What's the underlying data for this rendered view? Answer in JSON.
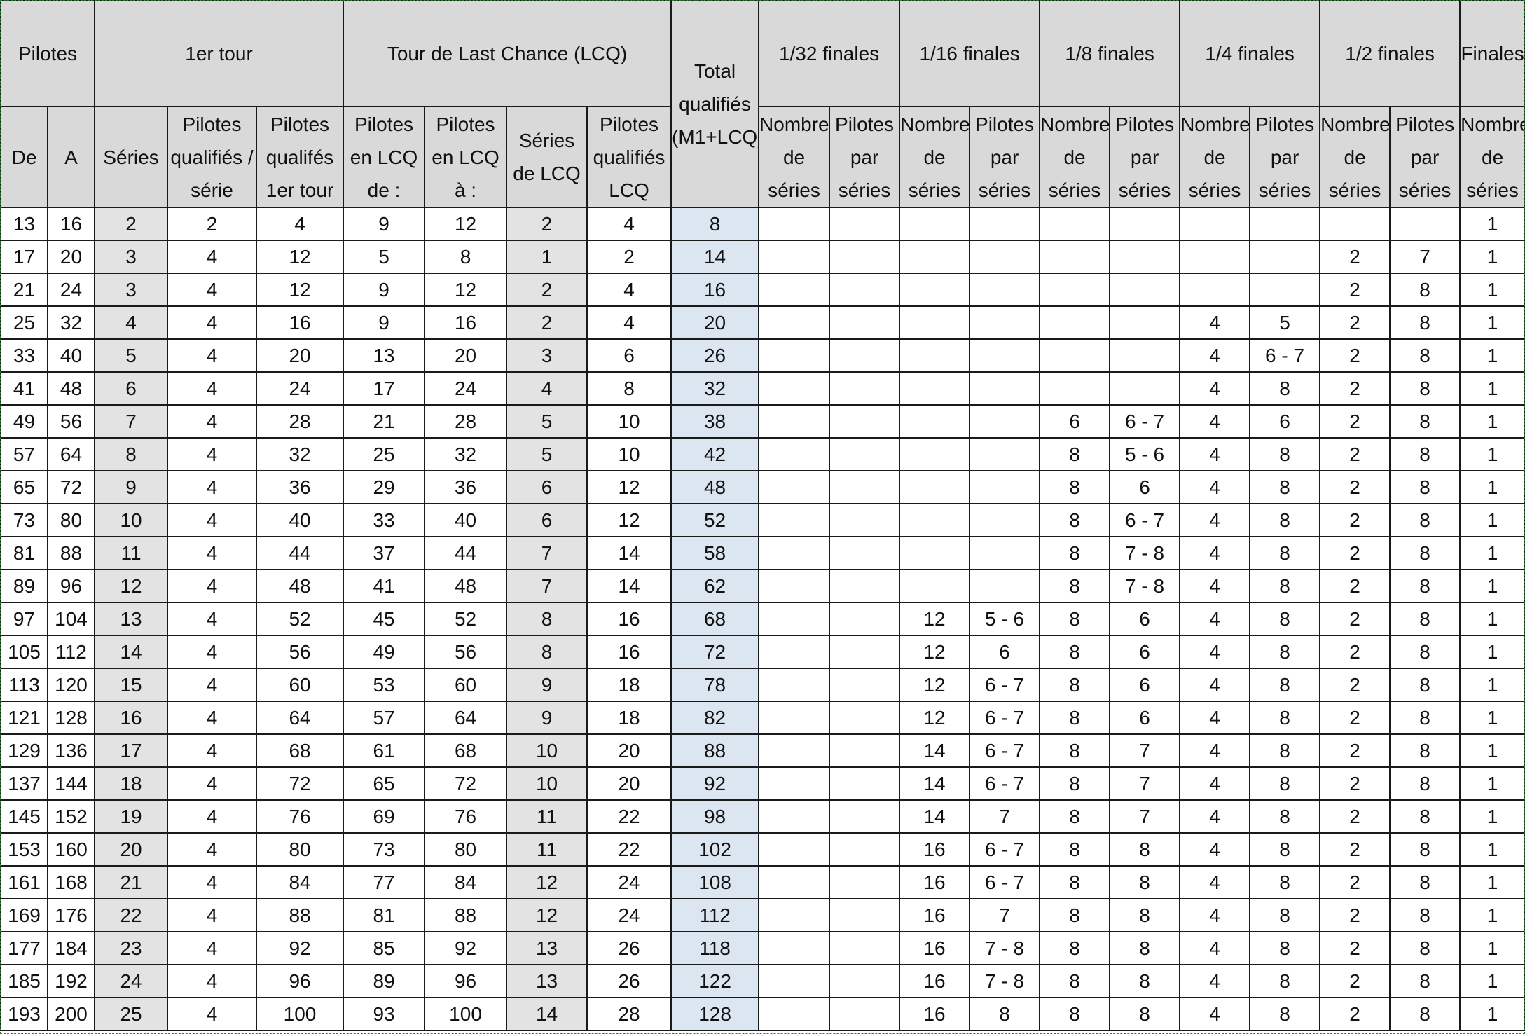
{
  "headers": {
    "pilotes": "Pilotes",
    "tour1": "1er tour",
    "lcq": "Tour de Last Chance (LCQ)",
    "total": "Total qualifiés (M1+LCQ)",
    "f32": "1/32 finales",
    "f16": "1/16 finales",
    "f8": "1/8 finales",
    "f4": "1/4 finales",
    "f2": "1/2 finales",
    "finales": "Finales",
    "de": "De",
    "a": "A",
    "series": "Séries",
    "pq_serie": "Pilotes qualifiés / série",
    "pq_1er": "Pilotes qualifés 1er tour",
    "lcq_de": "Pilotes en LCQ de :",
    "lcq_a": "Pilotes en LCQ à :",
    "lcq_series": "Séries de LCQ",
    "lcq_pq": "Pilotes qualifiés LCQ",
    "nombre_series": "Nombre de séries",
    "pilotes_par_series": "Pilotes par séries"
  },
  "columns": [
    "de",
    "a",
    "series",
    "pq_serie",
    "pq_1er",
    "lcq_de",
    "lcq_a",
    "lcq_series",
    "lcq_pq",
    "total",
    "f32_n",
    "f32_p",
    "f16_n",
    "f16_p",
    "f8_n",
    "f8_p",
    "f4_n",
    "f4_p",
    "f2_n",
    "f2_p",
    "fin_n"
  ],
  "rows": [
    [
      "13",
      "16",
      "2",
      "2",
      "4",
      "9",
      "12",
      "2",
      "4",
      "8",
      "",
      "",
      "",
      "",
      "",
      "",
      "",
      "",
      "",
      "",
      "1"
    ],
    [
      "17",
      "20",
      "3",
      "4",
      "12",
      "5",
      "8",
      "1",
      "2",
      "14",
      "",
      "",
      "",
      "",
      "",
      "",
      "",
      "",
      "2",
      "7",
      "1"
    ],
    [
      "21",
      "24",
      "3",
      "4",
      "12",
      "9",
      "12",
      "2",
      "4",
      "16",
      "",
      "",
      "",
      "",
      "",
      "",
      "",
      "",
      "2",
      "8",
      "1"
    ],
    [
      "25",
      "32",
      "4",
      "4",
      "16",
      "9",
      "16",
      "2",
      "4",
      "20",
      "",
      "",
      "",
      "",
      "",
      "",
      "4",
      "5",
      "2",
      "8",
      "1"
    ],
    [
      "33",
      "40",
      "5",
      "4",
      "20",
      "13",
      "20",
      "3",
      "6",
      "26",
      "",
      "",
      "",
      "",
      "",
      "",
      "4",
      "6 - 7",
      "2",
      "8",
      "1"
    ],
    [
      "41",
      "48",
      "6",
      "4",
      "24",
      "17",
      "24",
      "4",
      "8",
      "32",
      "",
      "",
      "",
      "",
      "",
      "",
      "4",
      "8",
      "2",
      "8",
      "1"
    ],
    [
      "49",
      "56",
      "7",
      "4",
      "28",
      "21",
      "28",
      "5",
      "10",
      "38",
      "",
      "",
      "",
      "",
      "6",
      "6 - 7",
      "4",
      "6",
      "2",
      "8",
      "1"
    ],
    [
      "57",
      "64",
      "8",
      "4",
      "32",
      "25",
      "32",
      "5",
      "10",
      "42",
      "",
      "",
      "",
      "",
      "8",
      "5 - 6",
      "4",
      "8",
      "2",
      "8",
      "1"
    ],
    [
      "65",
      "72",
      "9",
      "4",
      "36",
      "29",
      "36",
      "6",
      "12",
      "48",
      "",
      "",
      "",
      "",
      "8",
      "6",
      "4",
      "8",
      "2",
      "8",
      "1"
    ],
    [
      "73",
      "80",
      "10",
      "4",
      "40",
      "33",
      "40",
      "6",
      "12",
      "52",
      "",
      "",
      "",
      "",
      "8",
      "6 - 7",
      "4",
      "8",
      "2",
      "8",
      "1"
    ],
    [
      "81",
      "88",
      "11",
      "4",
      "44",
      "37",
      "44",
      "7",
      "14",
      "58",
      "",
      "",
      "",
      "",
      "8",
      "7 - 8",
      "4",
      "8",
      "2",
      "8",
      "1"
    ],
    [
      "89",
      "96",
      "12",
      "4",
      "48",
      "41",
      "48",
      "7",
      "14",
      "62",
      "",
      "",
      "",
      "",
      "8",
      "7 - 8",
      "4",
      "8",
      "2",
      "8",
      "1"
    ],
    [
      "97",
      "104",
      "13",
      "4",
      "52",
      "45",
      "52",
      "8",
      "16",
      "68",
      "",
      "",
      "12",
      "5 - 6",
      "8",
      "6",
      "4",
      "8",
      "2",
      "8",
      "1"
    ],
    [
      "105",
      "112",
      "14",
      "4",
      "56",
      "49",
      "56",
      "8",
      "16",
      "72",
      "",
      "",
      "12",
      "6",
      "8",
      "6",
      "4",
      "8",
      "2",
      "8",
      "1"
    ],
    [
      "113",
      "120",
      "15",
      "4",
      "60",
      "53",
      "60",
      "9",
      "18",
      "78",
      "",
      "",
      "12",
      "6 - 7",
      "8",
      "6",
      "4",
      "8",
      "2",
      "8",
      "1"
    ],
    [
      "121",
      "128",
      "16",
      "4",
      "64",
      "57",
      "64",
      "9",
      "18",
      "82",
      "",
      "",
      "12",
      "6 - 7",
      "8",
      "6",
      "4",
      "8",
      "2",
      "8",
      "1"
    ],
    [
      "129",
      "136",
      "17",
      "4",
      "68",
      "61",
      "68",
      "10",
      "20",
      "88",
      "",
      "",
      "14",
      "6 - 7",
      "8",
      "7",
      "4",
      "8",
      "2",
      "8",
      "1"
    ],
    [
      "137",
      "144",
      "18",
      "4",
      "72",
      "65",
      "72",
      "10",
      "20",
      "92",
      "",
      "",
      "14",
      "6 - 7",
      "8",
      "7",
      "4",
      "8",
      "2",
      "8",
      "1"
    ],
    [
      "145",
      "152",
      "19",
      "4",
      "76",
      "69",
      "76",
      "11",
      "22",
      "98",
      "",
      "",
      "14",
      "7",
      "8",
      "7",
      "4",
      "8",
      "2",
      "8",
      "1"
    ],
    [
      "153",
      "160",
      "20",
      "4",
      "80",
      "73",
      "80",
      "11",
      "22",
      "102",
      "",
      "",
      "16",
      "6 - 7",
      "8",
      "8",
      "4",
      "8",
      "2",
      "8",
      "1"
    ],
    [
      "161",
      "168",
      "21",
      "4",
      "84",
      "77",
      "84",
      "12",
      "24",
      "108",
      "",
      "",
      "16",
      "6 - 7",
      "8",
      "8",
      "4",
      "8",
      "2",
      "8",
      "1"
    ],
    [
      "169",
      "176",
      "22",
      "4",
      "88",
      "81",
      "88",
      "12",
      "24",
      "112",
      "",
      "",
      "16",
      "7",
      "8",
      "8",
      "4",
      "8",
      "2",
      "8",
      "1"
    ],
    [
      "177",
      "184",
      "23",
      "4",
      "92",
      "85",
      "92",
      "13",
      "26",
      "118",
      "",
      "",
      "16",
      "7 - 8",
      "8",
      "8",
      "4",
      "8",
      "2",
      "8",
      "1"
    ],
    [
      "185",
      "192",
      "24",
      "4",
      "96",
      "89",
      "96",
      "13",
      "26",
      "122",
      "",
      "",
      "16",
      "7 - 8",
      "8",
      "8",
      "4",
      "8",
      "2",
      "8",
      "1"
    ],
    [
      "193",
      "200",
      "25",
      "4",
      "100",
      "93",
      "100",
      "14",
      "28",
      "128",
      "",
      "",
      "16",
      "8",
      "8",
      "8",
      "4",
      "8",
      "2",
      "8",
      "1"
    ]
  ],
  "colors": {
    "header_bg": "#d9d9d9",
    "series_bg": "#e3e3e3",
    "total_bg": "#dce6f1",
    "grid": "#1a1a1a"
  }
}
